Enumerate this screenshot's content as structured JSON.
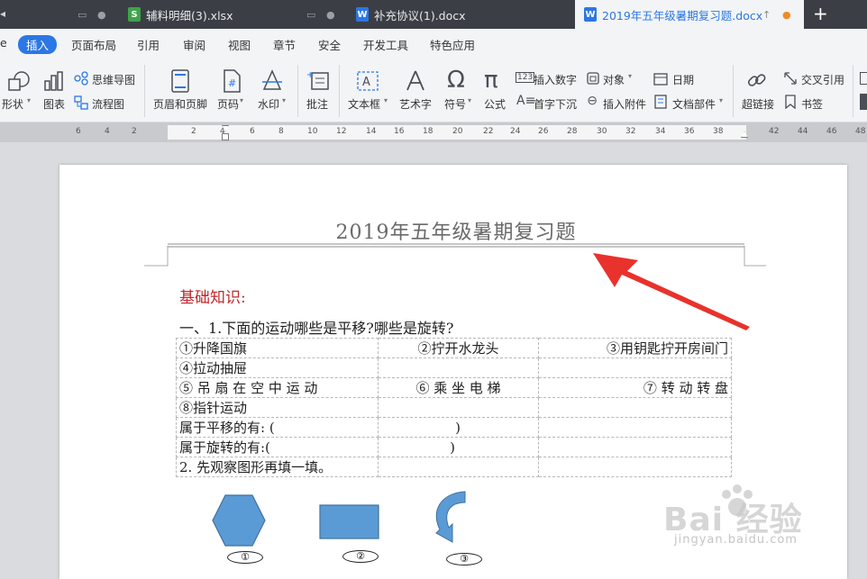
{
  "tabs": [
    {
      "label": "辅料明细(3).xlsx",
      "icon": "spreadsheet-icon",
      "color": "#3ea34b"
    },
    {
      "label": "补充协议(1).docx",
      "icon": "document-icon",
      "color": "#2b77e5"
    },
    {
      "label": "2019年五年级暑期复习题.docx",
      "icon": "document-icon",
      "color": "#2b77e5"
    }
  ],
  "new_tab_label": "+",
  "menu": [
    "插入",
    "页面布局",
    "引用",
    "审阅",
    "视图",
    "章节",
    "安全",
    "开发工具",
    "特色应用"
  ],
  "ribbon": {
    "shape": "形状",
    "chart": "图表",
    "mindmap": "思维导图",
    "flowchart": "流程图",
    "header_footer": "页眉和页脚",
    "page_number": "页码",
    "watermark": "水印",
    "comment": "批注",
    "textbox": "文本框",
    "wordart": "艺术字",
    "symbol": "符号",
    "formula": "公式",
    "insert_number": "插入数字",
    "object": "对象",
    "dropcap": "首字下沉",
    "attachment": "插入附件",
    "date": "日期",
    "doc_parts": "文档部件",
    "hyperlink": "超链接",
    "cross_ref": "交叉引用",
    "bookmark": "书签"
  },
  "ruler_numbers": [
    "6",
    "4",
    "2",
    "2",
    "4",
    "6",
    "8",
    "10",
    "12",
    "14",
    "16",
    "18",
    "20",
    "22",
    "24",
    "26",
    "28",
    "30",
    "32",
    "34",
    "36",
    "38",
    "42",
    "44",
    "46",
    "48"
  ],
  "document": {
    "title": "2019年五年级暑期复习题",
    "section_heading": "基础知识:",
    "question": "一、1.下面的运动哪些是平移?哪些是旋转?",
    "table": {
      "r1": [
        "①升降国旗",
        "②拧开水龙头",
        "③用钥匙拧开房间门"
      ],
      "r2": "④拉动抽屉",
      "r3": [
        "⑤ 吊 扇 在 空 中 运 动",
        "⑥ 乘 坐 电 梯",
        "⑦ 转 动 转 盘"
      ],
      "r4": "⑧指针运动",
      "r5": [
        "属于平移的有:  (",
        ")"
      ],
      "r6": [
        "属于旋转的有:(",
        ")"
      ],
      "r7": "2.  先观察图形再填一填。"
    },
    "figures": [
      "①",
      "②",
      "③"
    ],
    "shape_color": "#5b9bd5"
  },
  "watermark": {
    "main": "Bai  经验",
    "url": "jingyan.baidu.com"
  }
}
